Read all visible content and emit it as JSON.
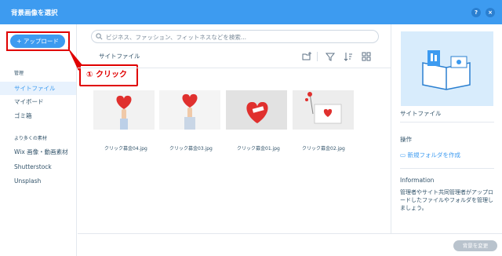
{
  "window": {
    "title": "背景画像を選択",
    "help_label": "?",
    "close_label": "×"
  },
  "sidebar": {
    "upload_label": "+ アップロード",
    "section_manage": "管理",
    "manage_items": [
      {
        "label": "サイトファイル",
        "active": true
      },
      {
        "label": "マイボード",
        "active": false
      },
      {
        "label": "ゴミ箱",
        "active": false
      }
    ],
    "section_more": "より多くの素材",
    "more_items": [
      {
        "label": "Wix 画像・動画素材"
      },
      {
        "label": "Shutterstock"
      },
      {
        "label": "Unsplash"
      }
    ]
  },
  "annotation": {
    "label": "① クリック",
    "color": "#e00000"
  },
  "search": {
    "placeholder": "ビジネス、ファッション、フィットネスなどを検索..."
  },
  "breadcrumb": "サイトファイル",
  "files": [
    {
      "name": "クリック募金04.jpg"
    },
    {
      "name": "クリック募金03.jpg"
    },
    {
      "name": "クリック募金01.jpg"
    },
    {
      "name": "クリック募金02.jpg"
    }
  ],
  "right_panel": {
    "folder_name": "サイトファイル",
    "actions_heading": "操作",
    "new_folder_label": "新規フォルダを作成",
    "info_heading": "Information",
    "info_text": "管理者やサイト共同管理者がアップロードしたファイルやフォルダを管理しましょう。"
  },
  "footer": {
    "change_bg_label": "背景を変更"
  },
  "colors": {
    "accent": "#3d9bf0",
    "annotation": "#e00000",
    "text": "#32536a"
  }
}
